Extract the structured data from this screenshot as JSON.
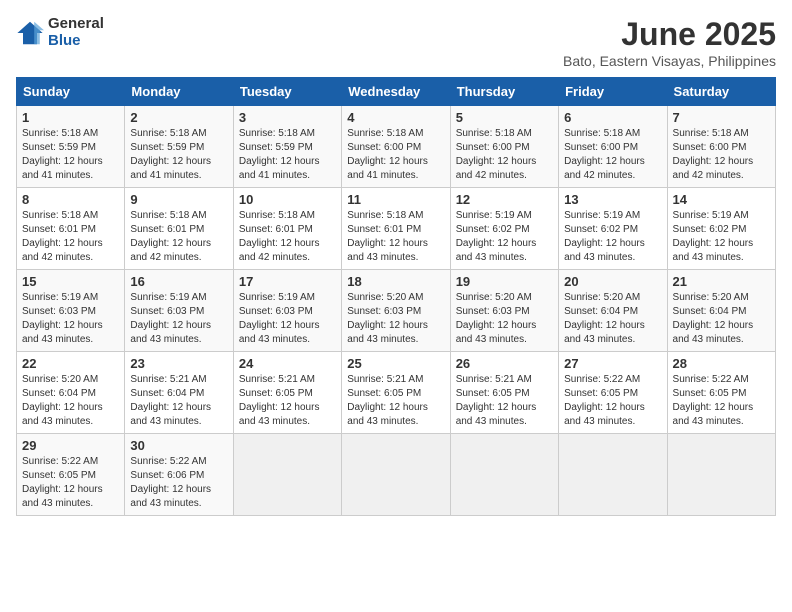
{
  "logo": {
    "general": "General",
    "blue": "Blue"
  },
  "title": "June 2025",
  "subtitle": "Bato, Eastern Visayas, Philippines",
  "weekdays": [
    "Sunday",
    "Monday",
    "Tuesday",
    "Wednesday",
    "Thursday",
    "Friday",
    "Saturday"
  ],
  "weeks": [
    [
      {
        "day": "1",
        "sunrise": "5:18 AM",
        "sunset": "5:59 PM",
        "daylight": "12 hours and 41 minutes"
      },
      {
        "day": "2",
        "sunrise": "5:18 AM",
        "sunset": "5:59 PM",
        "daylight": "12 hours and 41 minutes"
      },
      {
        "day": "3",
        "sunrise": "5:18 AM",
        "sunset": "5:59 PM",
        "daylight": "12 hours and 41 minutes"
      },
      {
        "day": "4",
        "sunrise": "5:18 AM",
        "sunset": "6:00 PM",
        "daylight": "12 hours and 41 minutes"
      },
      {
        "day": "5",
        "sunrise": "5:18 AM",
        "sunset": "6:00 PM",
        "daylight": "12 hours and 42 minutes"
      },
      {
        "day": "6",
        "sunrise": "5:18 AM",
        "sunset": "6:00 PM",
        "daylight": "12 hours and 42 minutes"
      },
      {
        "day": "7",
        "sunrise": "5:18 AM",
        "sunset": "6:00 PM",
        "daylight": "12 hours and 42 minutes"
      }
    ],
    [
      {
        "day": "8",
        "sunrise": "5:18 AM",
        "sunset": "6:01 PM",
        "daylight": "12 hours and 42 minutes"
      },
      {
        "day": "9",
        "sunrise": "5:18 AM",
        "sunset": "6:01 PM",
        "daylight": "12 hours and 42 minutes"
      },
      {
        "day": "10",
        "sunrise": "5:18 AM",
        "sunset": "6:01 PM",
        "daylight": "12 hours and 42 minutes"
      },
      {
        "day": "11",
        "sunrise": "5:18 AM",
        "sunset": "6:01 PM",
        "daylight": "12 hours and 43 minutes"
      },
      {
        "day": "12",
        "sunrise": "5:19 AM",
        "sunset": "6:02 PM",
        "daylight": "12 hours and 43 minutes"
      },
      {
        "day": "13",
        "sunrise": "5:19 AM",
        "sunset": "6:02 PM",
        "daylight": "12 hours and 43 minutes"
      },
      {
        "day": "14",
        "sunrise": "5:19 AM",
        "sunset": "6:02 PM",
        "daylight": "12 hours and 43 minutes"
      }
    ],
    [
      {
        "day": "15",
        "sunrise": "5:19 AM",
        "sunset": "6:03 PM",
        "daylight": "12 hours and 43 minutes"
      },
      {
        "day": "16",
        "sunrise": "5:19 AM",
        "sunset": "6:03 PM",
        "daylight": "12 hours and 43 minutes"
      },
      {
        "day": "17",
        "sunrise": "5:19 AM",
        "sunset": "6:03 PM",
        "daylight": "12 hours and 43 minutes"
      },
      {
        "day": "18",
        "sunrise": "5:20 AM",
        "sunset": "6:03 PM",
        "daylight": "12 hours and 43 minutes"
      },
      {
        "day": "19",
        "sunrise": "5:20 AM",
        "sunset": "6:03 PM",
        "daylight": "12 hours and 43 minutes"
      },
      {
        "day": "20",
        "sunrise": "5:20 AM",
        "sunset": "6:04 PM",
        "daylight": "12 hours and 43 minutes"
      },
      {
        "day": "21",
        "sunrise": "5:20 AM",
        "sunset": "6:04 PM",
        "daylight": "12 hours and 43 minutes"
      }
    ],
    [
      {
        "day": "22",
        "sunrise": "5:20 AM",
        "sunset": "6:04 PM",
        "daylight": "12 hours and 43 minutes"
      },
      {
        "day": "23",
        "sunrise": "5:21 AM",
        "sunset": "6:04 PM",
        "daylight": "12 hours and 43 minutes"
      },
      {
        "day": "24",
        "sunrise": "5:21 AM",
        "sunset": "6:05 PM",
        "daylight": "12 hours and 43 minutes"
      },
      {
        "day": "25",
        "sunrise": "5:21 AM",
        "sunset": "6:05 PM",
        "daylight": "12 hours and 43 minutes"
      },
      {
        "day": "26",
        "sunrise": "5:21 AM",
        "sunset": "6:05 PM",
        "daylight": "12 hours and 43 minutes"
      },
      {
        "day": "27",
        "sunrise": "5:22 AM",
        "sunset": "6:05 PM",
        "daylight": "12 hours and 43 minutes"
      },
      {
        "day": "28",
        "sunrise": "5:22 AM",
        "sunset": "6:05 PM",
        "daylight": "12 hours and 43 minutes"
      }
    ],
    [
      {
        "day": "29",
        "sunrise": "5:22 AM",
        "sunset": "6:05 PM",
        "daylight": "12 hours and 43 minutes"
      },
      {
        "day": "30",
        "sunrise": "5:22 AM",
        "sunset": "6:06 PM",
        "daylight": "12 hours and 43 minutes"
      },
      null,
      null,
      null,
      null,
      null
    ]
  ],
  "labels": {
    "sunrise": "Sunrise:",
    "sunset": "Sunset:",
    "daylight": "Daylight:"
  }
}
